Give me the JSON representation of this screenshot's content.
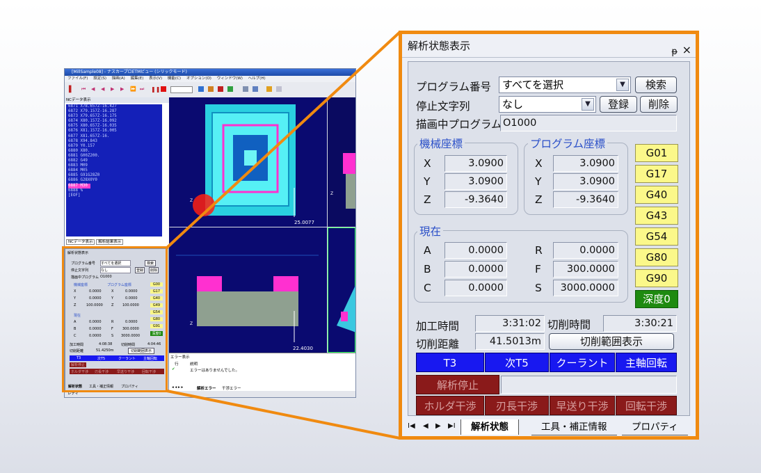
{
  "app": {
    "title": "[MillSample08] - ナスカープロETMビュー (シリックモード)",
    "menu": [
      "ファイル(F)",
      "設定(S)",
      "描画(A)",
      "編集(E)",
      "表示(V)",
      "機能(C)",
      "オプション(O)",
      "ウィンドウ(W)",
      "ヘルプ(H)"
    ],
    "nc_panel_title": "NCデータ表示",
    "nc_lines": [
      "6871 X78.657Z-16.427",
      "6872 X79.157Z-16.287",
      "6873 X79.657Z-16.175",
      "6874 X80.157Z-16.092",
      "6875 X80.657Z-16.035",
      "6876 X81.157Z-16.005",
      "6877 X81.657Z-16.",
      "6878 X94.843",
      "6879 Y0.157",
      "6880 X80.",
      "6881 G00Z200.",
      "6882 G49",
      "6883 M09",
      "6884 M05",
      "6885 G91G28Z0",
      "6886 G28X0Y0",
      "6887 M30",
      "6888 %",
      "[EOF]"
    ],
    "nc_tab1": "NCデータ表示",
    "nc_tab2": "解析結果表示",
    "view1_scale": "25.0077",
    "view3_scale": "22.4030",
    "error_title": "エラー表示",
    "error_col1": "行",
    "error_col2": "説明",
    "error_row": "エラーはありませんでした。",
    "bottom_tabs": [
      "解析状態",
      "工具・補正情報",
      "プロパティ"
    ],
    "error_tabs": [
      "解析エラー",
      "干渉エラー"
    ],
    "status": "レディ",
    "small_panel": {
      "title": "解析状態表示",
      "program_no_label": "プログラム番号",
      "program_no_value": "すべてを選択",
      "search": "検索",
      "stop_char_label": "停止文字列",
      "stop_char_value": "なし",
      "register": "登録",
      "delete": "削除",
      "drawing_label": "描画中プログラム",
      "drawing_value": "O1000",
      "machine": "機械座標",
      "program_coord": "プログラム座標",
      "mx": "0.0000",
      "my": "0.0000",
      "mz": "100.0000",
      "px": "0.0000",
      "py": "0.0000",
      "pz": "100.0000",
      "current": "現在",
      "a": "0.0000",
      "b": "0.0000",
      "c": "0.0000",
      "r": "0.0000",
      "f": "300.0000",
      "s": "3000.0000",
      "gcodes": [
        "G00",
        "G17",
        "G40",
        "G49",
        "G54",
        "G80",
        "G91",
        "深度0"
      ],
      "machining_time": "4:08:38",
      "cutting_time": "4:04:46",
      "cutting_distance": "51.4250m",
      "range_button": "切削範囲表示"
    }
  },
  "panel": {
    "title": "解析状態表示",
    "pin_icon": "ᵽ",
    "close_icon": "×",
    "program_no_label": "プログラム番号",
    "program_no_value": "すべてを選択",
    "search_button": "検索",
    "stop_char_label": "停止文字列",
    "stop_char_value": "なし",
    "register_button": "登録",
    "delete_button": "削除",
    "drawing_program_label": "描画中プログラム",
    "drawing_program_value": "O1000",
    "machine_coord_label": "機械座標",
    "program_coord_label": "プログラム座標",
    "machine": {
      "x_label": "X",
      "x": "3.0900",
      "y_label": "Y",
      "y": "3.0900",
      "z_label": "Z",
      "z": "-9.3640"
    },
    "program": {
      "x_label": "X",
      "x": "3.0900",
      "y_label": "Y",
      "y": "3.0900",
      "z_label": "Z",
      "z": "-9.3640"
    },
    "current_label": "現在",
    "current": {
      "a_label": "A",
      "a": "0.0000",
      "b_label": "B",
      "b": "0.0000",
      "c_label": "C",
      "c": "0.0000",
      "r_label": "R",
      "r": "0.0000",
      "f_label": "F",
      "f": "300.0000",
      "s_label": "S",
      "s": "3000.0000"
    },
    "gcodes": [
      "G01",
      "G17",
      "G40",
      "G43",
      "G54",
      "G80",
      "G90",
      "深度0"
    ],
    "machining_time_label": "加工時間",
    "machining_time": "3:31:02",
    "cutting_time_label": "切削時間",
    "cutting_time": "3:30:21",
    "cutting_distance_label": "切削距離",
    "cutting_distance": "41.5013m",
    "cutting_range_button": "切削範囲表示",
    "tool_status": [
      "T3",
      "次T5",
      "クーラント",
      "主軸回転"
    ],
    "analysis_stop": "解析停止",
    "interference": [
      "ホルダ干渉",
      "刃長干渉",
      "早送り干渉",
      "回転干渉"
    ],
    "tabs": [
      "解析状態",
      "工具・補正情報",
      "プロパティ"
    ],
    "colors": {
      "highlight": "#f08a10",
      "blue_button": "#1818f0",
      "red_button": "#8a1a1a",
      "gcode_bg": "#fbf88a",
      "depth_green": "#1e8a10"
    }
  }
}
